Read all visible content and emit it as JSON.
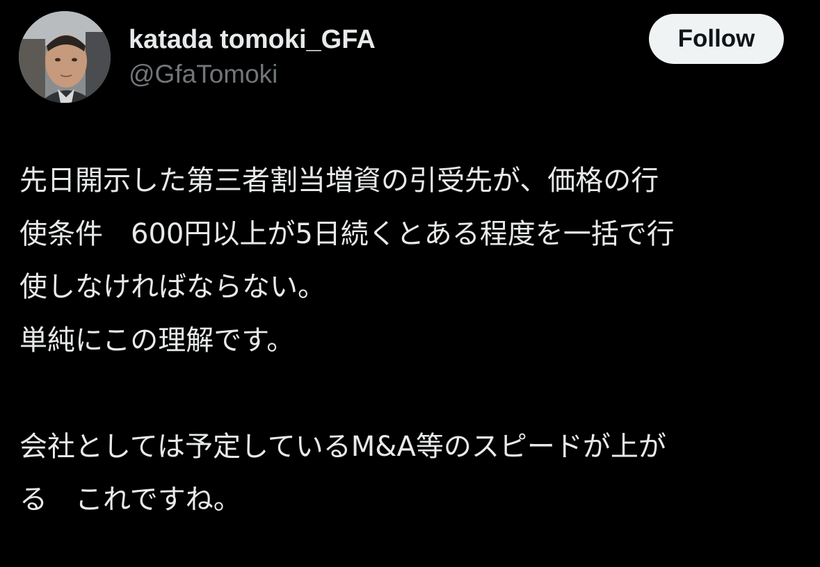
{
  "tweet": {
    "author": {
      "display_name": "katada tomoki_GFA",
      "handle": "@GfaTomoki"
    },
    "follow_label": "Follow",
    "lines": [
      "先日開示した第三者割当増資の引受先が、価格の行",
      "使条件　600円以上が5日続くとある程度を一括で行",
      "使しなければならない。",
      "単純にこの理解です。",
      "",
      "会社としては予定しているM&A等のスピードが上が",
      "る　これですね。"
    ]
  },
  "colors": {
    "background": "#000000",
    "text_primary": "#e7e9ea",
    "text_secondary": "#71767b",
    "button_bg": "#eff3f4",
    "button_text": "#0f1419"
  }
}
